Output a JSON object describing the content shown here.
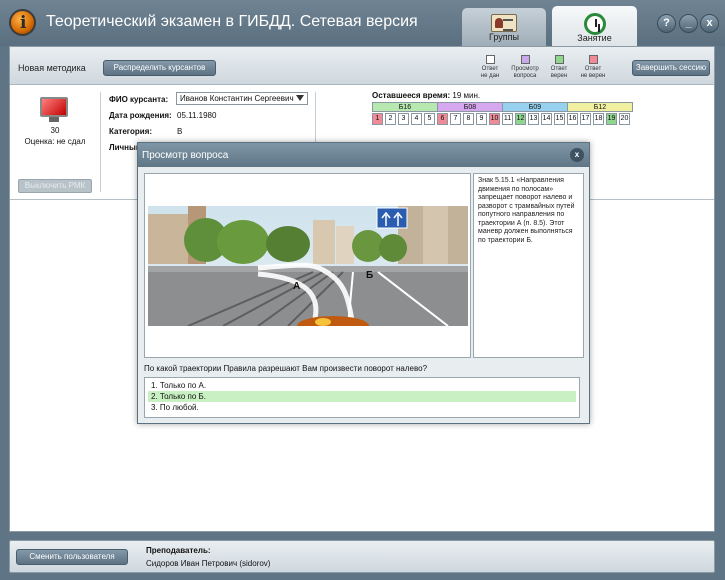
{
  "window": {
    "title": "Теоретический экзамен в ГИБДД. Сетевая версия",
    "help_btn": "?",
    "minimize_btn": "_",
    "close_btn": "x"
  },
  "tabs": [
    {
      "label": "Группы",
      "icon": "groups-icon"
    },
    {
      "label": "Занятие",
      "icon": "lesson-clock-icon",
      "active": true
    }
  ],
  "toolbar": {
    "method_label": "Новая методика",
    "distribute_btn": "Распределить курсантов",
    "finish_btn": "Завершить сессию",
    "legend": [
      {
        "line1": "Ответ",
        "line2": "не дан",
        "color": "#ffffff"
      },
      {
        "line1": "Просмотр",
        "line2": "вопроса",
        "color": "#c8a8e8"
      },
      {
        "line1": "Ответ",
        "line2": "верен",
        "color": "#8fd68f"
      },
      {
        "line1": "Ответ",
        "line2": "не верен",
        "color": "#f08a96"
      }
    ]
  },
  "student": {
    "seat": "30",
    "score": "Оценка: не сдал",
    "disable_btn": "Выключить РМК",
    "fio_label": "ФИО курсанта:",
    "fio_value": "Иванов Константин Сергеевич",
    "dob_label": "Дата рождения:",
    "dob_value": "05.11.1980",
    "category_label": "Категория:",
    "category_value": "B",
    "personal_label": "Личный"
  },
  "exam": {
    "time_label": "Оставшееся время:",
    "time_value": "19 мин.",
    "blocks": [
      {
        "label": "Б16",
        "color": "#b6e8b0"
      },
      {
        "label": "Б08",
        "color": "#d6a8f0"
      },
      {
        "label": "Б09",
        "color": "#98d0f0"
      },
      {
        "label": "Б12",
        "color": "#f0f0a0"
      }
    ],
    "questions": [
      {
        "n": "1",
        "status": "wrong"
      },
      {
        "n": "2",
        "status": "none"
      },
      {
        "n": "3",
        "status": "none"
      },
      {
        "n": "4",
        "status": "none"
      },
      {
        "n": "5",
        "status": "none"
      },
      {
        "n": "6",
        "status": "wrong"
      },
      {
        "n": "7",
        "status": "none"
      },
      {
        "n": "8",
        "status": "none"
      },
      {
        "n": "9",
        "status": "none"
      },
      {
        "n": "10",
        "status": "wrong"
      },
      {
        "n": "11",
        "status": "none"
      },
      {
        "n": "12",
        "status": "correct"
      },
      {
        "n": "13",
        "status": "none"
      },
      {
        "n": "14",
        "status": "none"
      },
      {
        "n": "15",
        "status": "none"
      },
      {
        "n": "16",
        "status": "none"
      },
      {
        "n": "17",
        "status": "none"
      },
      {
        "n": "18",
        "status": "none"
      },
      {
        "n": "19",
        "status": "correct"
      },
      {
        "n": "20",
        "status": "none"
      }
    ],
    "status_colors": {
      "none": "#ffffff",
      "wrong": "#f08a96",
      "correct": "#8fd68f",
      "viewed": "#c8a8e8"
    }
  },
  "modal": {
    "title": "Просмотр вопроса",
    "close": "x",
    "label_a": "А",
    "label_b": "Б",
    "explanation": "Знак 5.15.1 «Направления движения по полосам» запрещает поворот налево и разворот с трамвайных путей попутного направления по траектории А (п. 8.5). Этот маневр должен выполняться по траектории Б.",
    "question": "По какой траектории Правила разрешают Вам произвести поворот налево?",
    "answers": [
      {
        "text": "1. Только по А.",
        "correct": false
      },
      {
        "text": "2. Только по Б.",
        "correct": true
      },
      {
        "text": "3. По любой.",
        "correct": false
      }
    ]
  },
  "bottom": {
    "switch_user_btn": "Сменить пользователя",
    "teacher_label": "Преподаватель:",
    "teacher_name": "Сидоров Иван Петрович (sidorov)"
  }
}
